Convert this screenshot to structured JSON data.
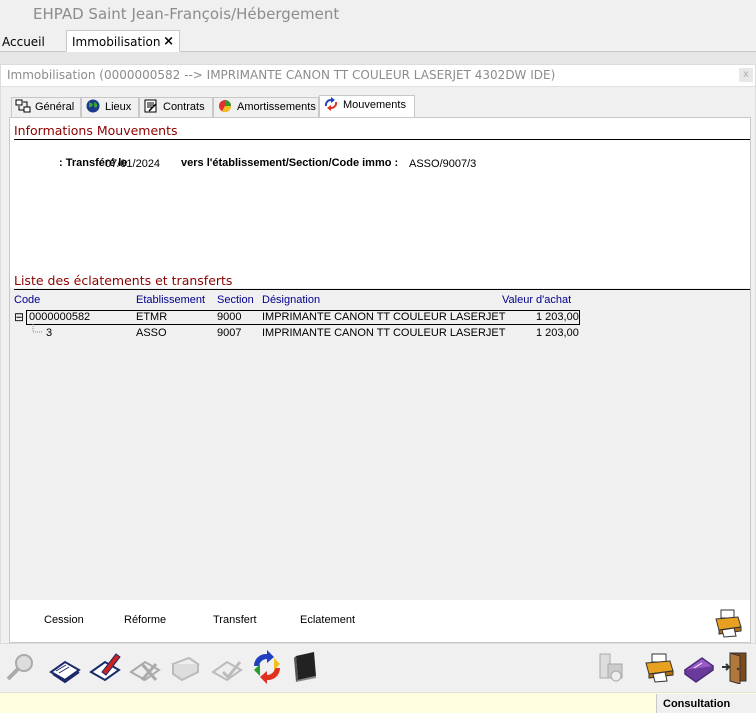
{
  "app": {
    "title": "EHPAD Saint Jean-François/Hébergement"
  },
  "doc_tabs": [
    {
      "label": "Accueil"
    },
    {
      "label": "Immobilisation",
      "close": "×"
    }
  ],
  "panel": {
    "title": "Immobilisation (0000000582 --> IMPRIMANTE CANON TT COULEUR LASERJET 4302DW IDE)",
    "close": "x"
  },
  "inner_tabs": [
    {
      "label": "Général",
      "icon": "general-icon"
    },
    {
      "label": "Lieux",
      "icon": "globe-icon"
    },
    {
      "label": "Contrats",
      "icon": "contract-icon"
    },
    {
      "label": "Amortissements",
      "icon": "chart-pie-icon"
    },
    {
      "label": "Mouvements",
      "icon": "movements-icon",
      "active": true
    }
  ],
  "info": {
    "section_title": "Informations Mouvements",
    "transfer_label": ": Transféré le",
    "transfer_date": "07/01/2024",
    "dest_label": "vers l'établissement/Section/Code immo :",
    "dest_value": "ASSO/9007/3"
  },
  "list": {
    "section_title": "Liste des éclatements et transferts",
    "columns": {
      "code": "Code",
      "etablissement": "Etablissement",
      "section": "Section",
      "designation": "Désignation",
      "valeur": "Valeur d'achat"
    },
    "rows": [
      {
        "toggle": "⊟",
        "code": "0000000582",
        "etablissement": "ETMR",
        "section": "9000",
        "designation": "IMPRIMANTE CANON TT COULEUR LASERJET",
        "valeur": "1 203,00"
      },
      {
        "code": "3",
        "etablissement": "ASSO",
        "section": "9007",
        "designation": "IMPRIMANTE CANON TT COULEUR LASERJET",
        "valeur": "1 203,00"
      }
    ]
  },
  "actions": {
    "cession": "Cession",
    "reforme": "Réforme",
    "transfert": "Transfert",
    "eclatement": "Eclatement"
  },
  "status": {
    "mode": "Consultation"
  },
  "colors": {
    "section_title": "#8b0000",
    "column_header": "#00008b",
    "status_bg": "#fffde0"
  }
}
